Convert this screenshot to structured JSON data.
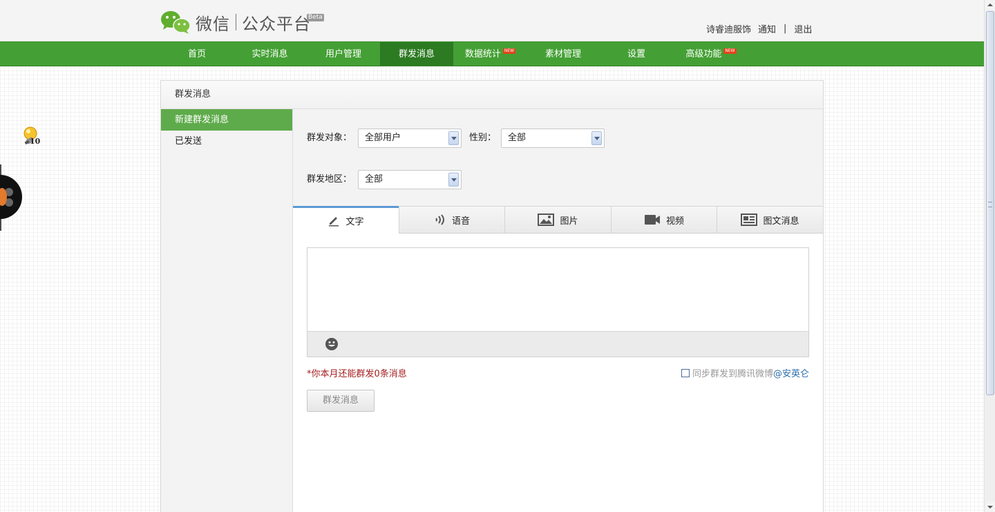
{
  "header": {
    "brand": "微信",
    "platform": "公众平台",
    "beta": "Beta",
    "account": "诗睿迪服饰",
    "notify_link": "通知",
    "separator": "|",
    "logout_link": "退出"
  },
  "nav": {
    "items": [
      {
        "label": "首页"
      },
      {
        "label": "实时消息"
      },
      {
        "label": "用户管理"
      },
      {
        "label": "群发消息",
        "active": true
      },
      {
        "label": "数据统计",
        "badge": "NEW"
      },
      {
        "label": "素材管理"
      },
      {
        "label": "设置"
      },
      {
        "label": "高级功能",
        "badge": "NEW"
      }
    ]
  },
  "widgets": {
    "bulb_count": "10"
  },
  "panel": {
    "title": "群发消息",
    "sidebar": [
      {
        "label": "新建群发消息",
        "active": true
      },
      {
        "label": "已发送"
      }
    ],
    "filters": {
      "target_label": "群发对象：",
      "target_value": "全部用户",
      "gender_label": "性别：",
      "gender_value": "全部",
      "region_label": "群发地区：",
      "region_value": "全部"
    },
    "tabs": [
      {
        "label": "文字",
        "icon": "pencil-icon",
        "active": true
      },
      {
        "label": "语音",
        "icon": "voice-icon"
      },
      {
        "label": "图片",
        "icon": "image-icon"
      },
      {
        "label": "视频",
        "icon": "video-icon"
      },
      {
        "label": "图文消息",
        "icon": "article-icon"
      }
    ],
    "editor_value": "",
    "quota_text": "*你本月还能群发0条消息",
    "sync_text": "同步群发到腾讯微博",
    "sync_account": "@安英仑",
    "send_button": "群发消息"
  },
  "colors": {
    "nav_green": "#44a034",
    "nav_active": "#2c7a22",
    "sidebar_active": "#5eab4b",
    "quota_red": "#a41d1d",
    "link_blue": "#2a6ba8",
    "tab_active_border": "#5b9bd5"
  }
}
